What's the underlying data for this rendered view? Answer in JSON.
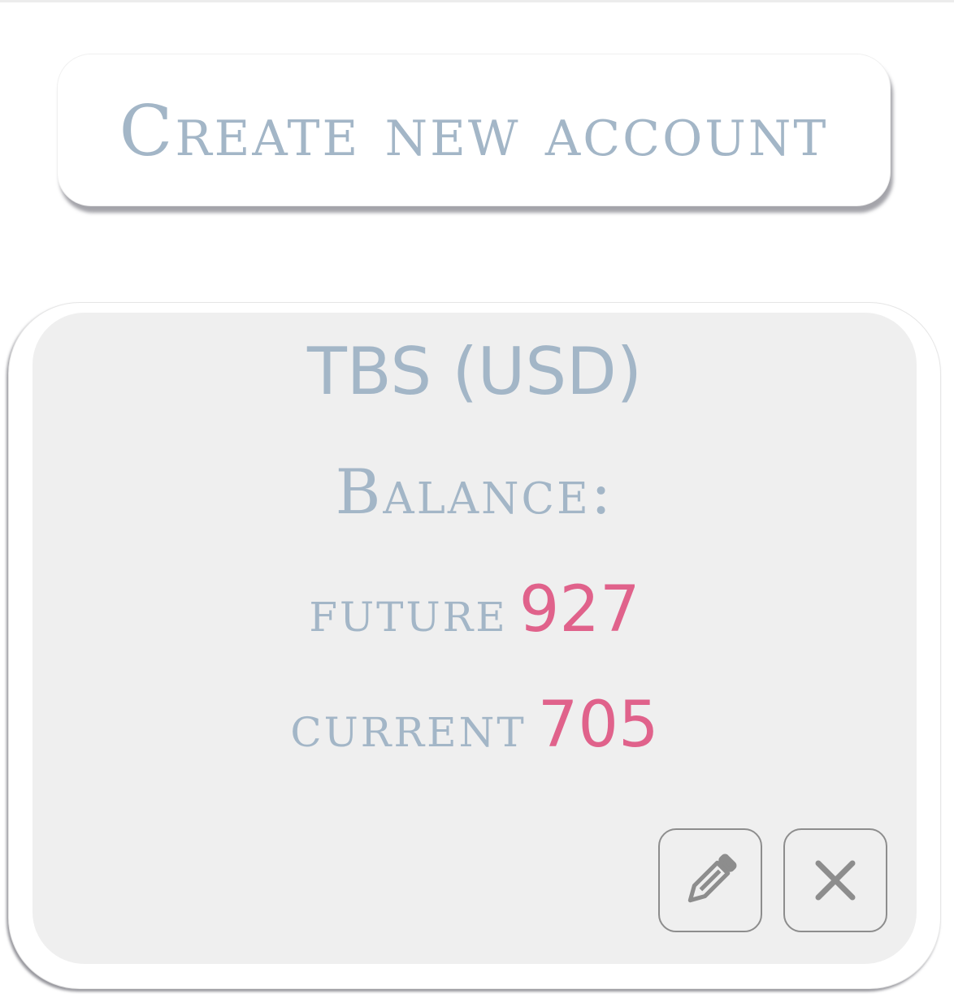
{
  "create_account": {
    "label": "Create new account"
  },
  "account_card": {
    "title": "TBS (USD)",
    "balance_label": "Balance:",
    "future_label": "future",
    "future_value": "927",
    "current_label": "current",
    "current_value": "705",
    "edit_icon": "pencil-icon",
    "delete_icon": "close-icon"
  },
  "colors": {
    "text_muted_blue": "#a3b6c7",
    "value_pink": "#e0628b",
    "card_background": "#efefef",
    "icon_border": "#8d8d8d"
  }
}
